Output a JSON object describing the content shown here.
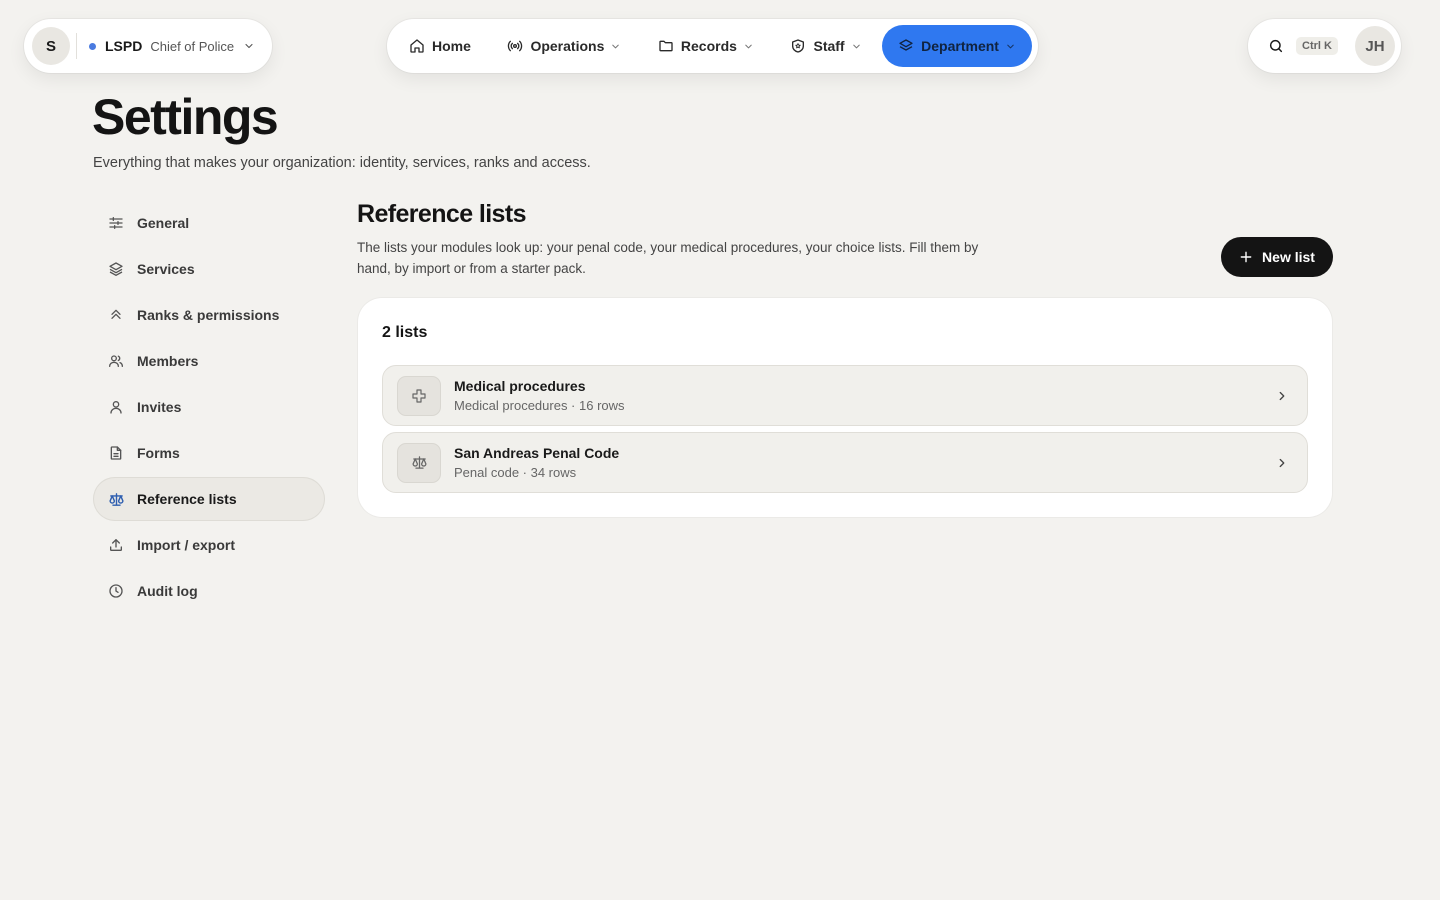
{
  "org": {
    "avatar_initial": "S",
    "name": "LSPD",
    "role": "Chief of Police",
    "status_color": "#4a7be0"
  },
  "nav": {
    "items": [
      {
        "label": "Home",
        "icon": "home-icon"
      },
      {
        "label": "Operations",
        "icon": "broadcast-icon"
      },
      {
        "label": "Records",
        "icon": "folder-icon"
      },
      {
        "label": "Staff",
        "icon": "shield-icon"
      },
      {
        "label": "Department",
        "icon": "layers-icon",
        "active": true
      }
    ],
    "accent_color": "#2f78f0"
  },
  "topbar": {
    "search_shortcut": "Ctrl K",
    "user_initials": "JH"
  },
  "header": {
    "title": "Settings",
    "subtitle": "Everything that makes your organization: identity, services, ranks and access."
  },
  "sidebar": {
    "items": [
      {
        "label": "General",
        "icon": "sliders-icon"
      },
      {
        "label": "Services",
        "icon": "layers-icon"
      },
      {
        "label": "Ranks & permissions",
        "icon": "chevrons-up-icon"
      },
      {
        "label": "Members",
        "icon": "users-icon"
      },
      {
        "label": "Invites",
        "icon": "user-icon"
      },
      {
        "label": "Forms",
        "icon": "file-text-icon"
      },
      {
        "label": "Reference lists",
        "icon": "scale-icon",
        "active": true
      },
      {
        "label": "Import / export",
        "icon": "upload-icon"
      },
      {
        "label": "Audit log",
        "icon": "clock-icon"
      }
    ]
  },
  "main": {
    "title": "Reference lists",
    "description": "The lists your modules look up: your penal code, your medical procedures, your choice lists. Fill them by hand, by import or from a starter pack.",
    "new_button_label": "New list",
    "count_label": "2 lists",
    "lists": [
      {
        "title": "Medical procedures",
        "meta": "Medical procedures · 16 rows",
        "icon": "medical-cross-icon"
      },
      {
        "title": "San Andreas Penal Code",
        "meta": "Penal code · 34 rows",
        "icon": "scale-icon"
      }
    ]
  }
}
